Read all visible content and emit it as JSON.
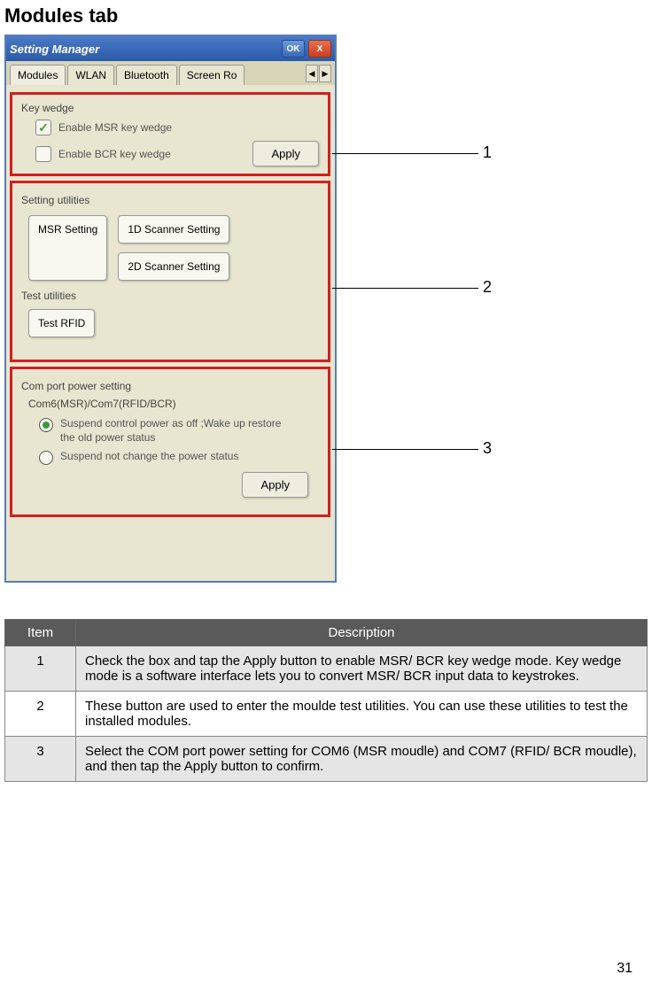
{
  "page_title": "Modules tab",
  "window": {
    "title": "Setting Manager",
    "ok_label": "OK",
    "close_label": "X",
    "tabs": [
      "Modules",
      "WLAN",
      "Bluetooth",
      "Screen Ro"
    ]
  },
  "key_wedge": {
    "legend": "Key wedge",
    "chk_msr": "Enable MSR key wedge",
    "chk_bcr": "Enable BCR key wedge",
    "apply": "Apply"
  },
  "setting_utils": {
    "legend": "Setting utilities",
    "msr": "MSR Setting",
    "scan1d": "1D Scanner Setting",
    "scan2d": "2D Scanner Setting"
  },
  "test_utils": {
    "legend": "Test utilities",
    "rfid": "Test RFID"
  },
  "comport": {
    "legend": "Com port power setting",
    "sub": "Com6(MSR)/Com7(RFID/BCR)",
    "opt1": "Suspend control power as off ;Wake up restore the old power status",
    "opt2": "Suspend not change the power status",
    "apply": "Apply"
  },
  "callouts": {
    "c1": "1",
    "c2": "2",
    "c3": "3"
  },
  "table": {
    "head_item": "Item",
    "head_desc": "Description",
    "rows": [
      {
        "n": "1",
        "d": "Check the box and tap the Apply button to enable MSR/ BCR key wedge mode. Key wedge mode is a software interface lets you to convert MSR/ BCR input data to keystrokes."
      },
      {
        "n": "2",
        "d": "These button are used to enter the moulde test utilities. You can use these utilities to test the installed modules."
      },
      {
        "n": "3",
        "d": "Select the COM port power setting for COM6 (MSR moudle) and COM7 (RFID/ BCR moudle), and then tap the Apply button to confirm."
      }
    ]
  },
  "page_number": "31"
}
